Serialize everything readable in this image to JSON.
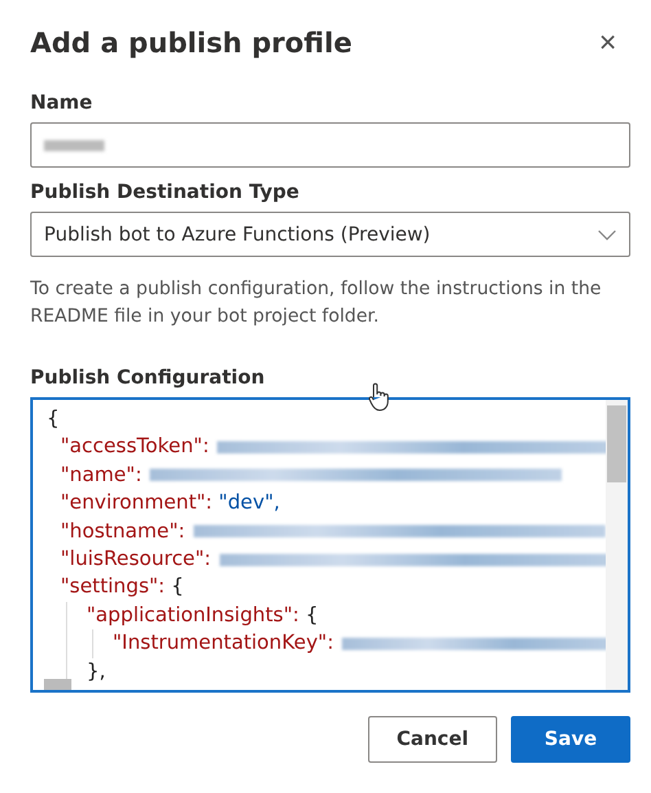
{
  "dialog": {
    "title": "Add a publish profile",
    "close": "×"
  },
  "name_field": {
    "label": "Name",
    "value_redacted": true
  },
  "destination": {
    "label": "Publish Destination Type",
    "value": "Publish bot to Azure Functions (Preview)"
  },
  "description": "To create a publish configuration, follow the instructions in the README file in your bot project folder.",
  "configuration": {
    "label": "Publish Configuration",
    "focused": true,
    "open": "{",
    "entries": [
      {
        "key": "\"accessToken\":",
        "kind": "redacted"
      },
      {
        "key": "\"name\":",
        "kind": "redacted"
      },
      {
        "key": "\"environment\":",
        "kind": "string",
        "value": "\"dev\","
      },
      {
        "key": "\"hostname\":",
        "kind": "redacted"
      },
      {
        "key": "\"luisResource\":",
        "kind": "redacted"
      },
      {
        "key": "\"settings\":",
        "kind": "object",
        "open": "{",
        "children": [
          {
            "key": "\"applicationInsights\":",
            "kind": "object",
            "open": "{",
            "close": "},",
            "children": [
              {
                "key": "\"InstrumentationKey\":",
                "kind": "redacted"
              }
            ]
          }
        ]
      }
    ]
  },
  "buttons": [
    {
      "label": "Cancel",
      "kind": "secondary"
    },
    {
      "label": "Save",
      "kind": "primary"
    }
  ]
}
